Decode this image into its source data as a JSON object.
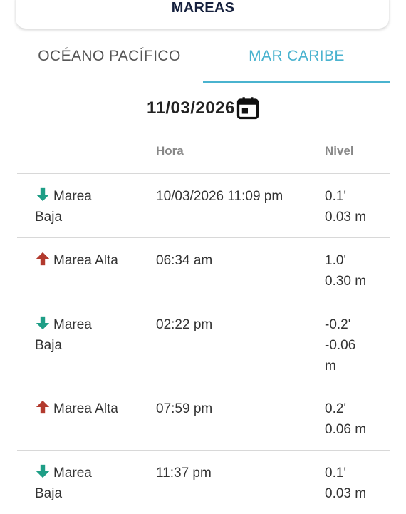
{
  "header": {
    "title": "MAREAS"
  },
  "tabs": [
    {
      "label": "OCÉANO PACÍFICO",
      "active": false
    },
    {
      "label": "MAR CARIBE",
      "active": true
    }
  ],
  "date_picker": {
    "value": "11/03/2026",
    "icon": "calendar-icon"
  },
  "table": {
    "columns": [
      "",
      "Hora",
      "Nivel"
    ],
    "rows": [
      {
        "tipo": "Marea Baja",
        "icon": "arrow-down-icon",
        "hora": "10/03/2026 11:09 pm",
        "nivel_ft": "0.1'",
        "nivel_m": "0.03 m"
      },
      {
        "tipo": "Marea Alta",
        "icon": "arrow-up-icon",
        "hora": "06:34 am",
        "nivel_ft": "1.0'",
        "nivel_m": "0.30 m"
      },
      {
        "tipo": "Marea Baja",
        "icon": "arrow-down-icon",
        "hora": "02:22 pm",
        "nivel_ft": "-0.2'",
        "nivel_m": "-0.06 m"
      },
      {
        "tipo": "Marea Alta",
        "icon": "arrow-up-icon",
        "hora": "07:59 pm",
        "nivel_ft": "0.2'",
        "nivel_m": "0.06 m"
      },
      {
        "tipo": "Marea Baja",
        "icon": "arrow-down-icon",
        "hora": "11:37 pm",
        "nivel_ft": "0.1'",
        "nivel_m": "0.03 m"
      }
    ]
  },
  "colors": {
    "accent": "#4ab3cf",
    "title": "#16213e",
    "low_tide": "#1e9e86",
    "high_tide": "#b23a2e"
  }
}
